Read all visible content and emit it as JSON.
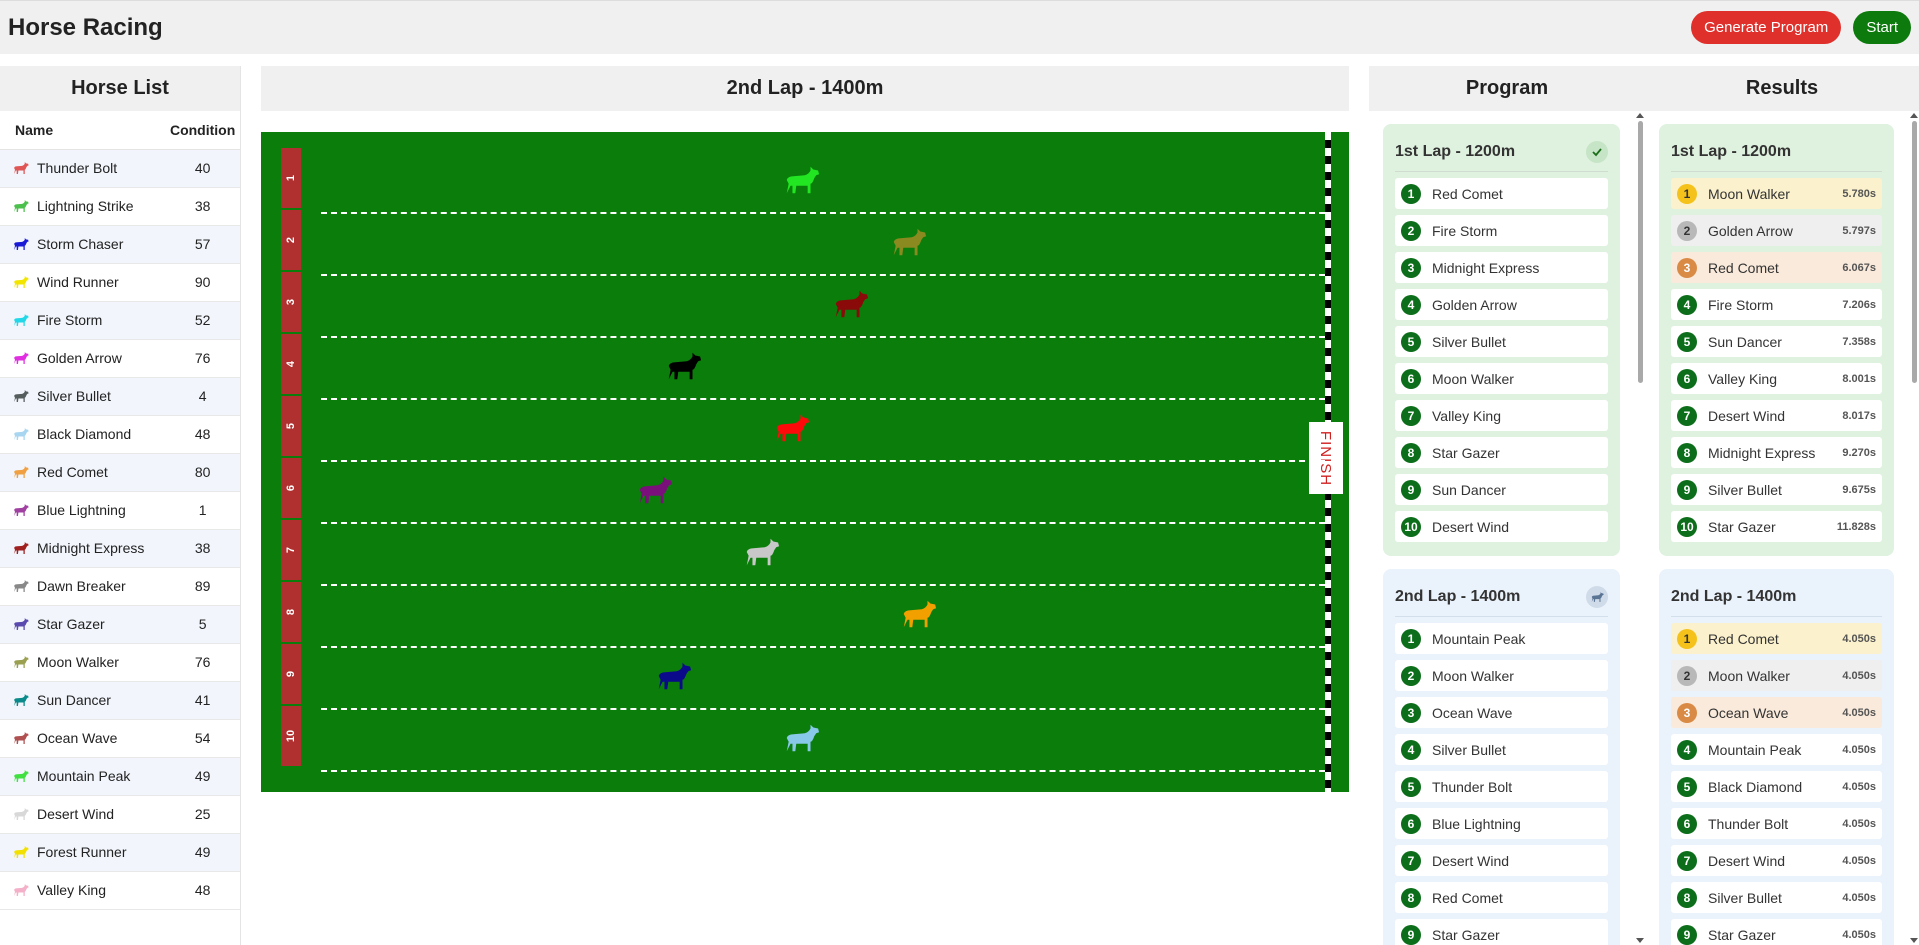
{
  "app": {
    "title": "Horse Racing"
  },
  "actions": {
    "generate_label": "Generate Program",
    "start_label": "Start"
  },
  "horse_list": {
    "title": "Horse List",
    "col_name": "Name",
    "col_condition": "Condition",
    "horses": [
      {
        "name": "Thunder Bolt",
        "condition": "40",
        "color": "#e05555"
      },
      {
        "name": "Lightning Strike",
        "condition": "38",
        "color": "#4cc04c"
      },
      {
        "name": "Storm Chaser",
        "condition": "57",
        "color": "#1a1ad6"
      },
      {
        "name": "Wind Runner",
        "condition": "90",
        "color": "#f2e600"
      },
      {
        "name": "Fire Storm",
        "condition": "52",
        "color": "#22d8e8"
      },
      {
        "name": "Golden Arrow",
        "condition": "76",
        "color": "#e02ee0"
      },
      {
        "name": "Silver Bullet",
        "condition": "4",
        "color": "#555d5d"
      },
      {
        "name": "Black Diamond",
        "condition": "48",
        "color": "#a8d6f0"
      },
      {
        "name": "Red Comet",
        "condition": "80",
        "color": "#f0a040"
      },
      {
        "name": "Blue Lightning",
        "condition": "1",
        "color": "#a040a0"
      },
      {
        "name": "Midnight Express",
        "condition": "38",
        "color": "#a02020"
      },
      {
        "name": "Dawn Breaker",
        "condition": "89",
        "color": "#888888"
      },
      {
        "name": "Star Gazer",
        "condition": "5",
        "color": "#5a4ab0"
      },
      {
        "name": "Moon Walker",
        "condition": "76",
        "color": "#9aa050"
      },
      {
        "name": "Sun Dancer",
        "condition": "41",
        "color": "#0a8a8a"
      },
      {
        "name": "Ocean Wave",
        "condition": "54",
        "color": "#b05050"
      },
      {
        "name": "Mountain Peak",
        "condition": "49",
        "color": "#40e040"
      },
      {
        "name": "Desert Wind",
        "condition": "25",
        "color": "#d8d8d8"
      },
      {
        "name": "Forest Runner",
        "condition": "49",
        "color": "#f2e000"
      },
      {
        "name": "Valley King",
        "condition": "48",
        "color": "#f4b0c8"
      }
    ]
  },
  "race": {
    "title": "2nd Lap - 1400m",
    "finish_label": "FINISH",
    "lanes": [
      {
        "number": "1",
        "color": "#22e622",
        "progress": 0.47
      },
      {
        "number": "2",
        "color": "#8a8a20",
        "progress": 0.58
      },
      {
        "number": "3",
        "color": "#8a0a0a",
        "progress": 0.52
      },
      {
        "number": "4",
        "color": "#000000",
        "progress": 0.35
      },
      {
        "number": "5",
        "color": "#ff0a0a",
        "progress": 0.46
      },
      {
        "number": "6",
        "color": "#7a107a",
        "progress": 0.32
      },
      {
        "number": "7",
        "color": "#c8c8c8",
        "progress": 0.43
      },
      {
        "number": "8",
        "color": "#f2a000",
        "progress": 0.59
      },
      {
        "number": "9",
        "color": "#0a0a8a",
        "progress": 0.34
      },
      {
        "number": "10",
        "color": "#88c8e8",
        "progress": 0.47
      }
    ]
  },
  "program": {
    "title": "Program",
    "laps": [
      {
        "title": "1st Lap - 1200m",
        "status_icon": "check-icon",
        "entries": [
          "Red Comet",
          "Fire Storm",
          "Midnight Express",
          "Golden Arrow",
          "Silver Bullet",
          "Moon Walker",
          "Valley King",
          "Star Gazer",
          "Sun Dancer",
          "Desert Wind"
        ]
      },
      {
        "title": "2nd Lap - 1400m",
        "status_icon": "horse-running-icon",
        "entries": [
          "Mountain Peak",
          "Moon Walker",
          "Ocean Wave",
          "Silver Bullet",
          "Thunder Bolt",
          "Blue Lightning",
          "Desert Wind",
          "Red Comet",
          "Star Gazer"
        ]
      }
    ]
  },
  "results": {
    "title": "Results",
    "laps": [
      {
        "title": "1st Lap - 1200m",
        "entries": [
          {
            "name": "Moon Walker",
            "time": "5.780s"
          },
          {
            "name": "Golden Arrow",
            "time": "5.797s"
          },
          {
            "name": "Red Comet",
            "time": "6.067s"
          },
          {
            "name": "Fire Storm",
            "time": "7.206s"
          },
          {
            "name": "Sun Dancer",
            "time": "7.358s"
          },
          {
            "name": "Valley King",
            "time": "8.001s"
          },
          {
            "name": "Desert Wind",
            "time": "8.017s"
          },
          {
            "name": "Midnight Express",
            "time": "9.270s"
          },
          {
            "name": "Silver Bullet",
            "time": "9.675s"
          },
          {
            "name": "Star Gazer",
            "time": "11.828s"
          }
        ]
      },
      {
        "title": "2nd Lap - 1400m",
        "entries": [
          {
            "name": "Red Comet",
            "time": "4.050s"
          },
          {
            "name": "Moon Walker",
            "time": "4.050s"
          },
          {
            "name": "Ocean Wave",
            "time": "4.050s"
          },
          {
            "name": "Mountain Peak",
            "time": "4.050s"
          },
          {
            "name": "Black Diamond",
            "time": "4.050s"
          },
          {
            "name": "Thunder Bolt",
            "time": "4.050s"
          },
          {
            "name": "Desert Wind",
            "time": "4.050s"
          },
          {
            "name": "Silver Bullet",
            "time": "4.050s"
          },
          {
            "name": "Star Gazer",
            "time": "4.050s"
          }
        ]
      }
    ]
  }
}
